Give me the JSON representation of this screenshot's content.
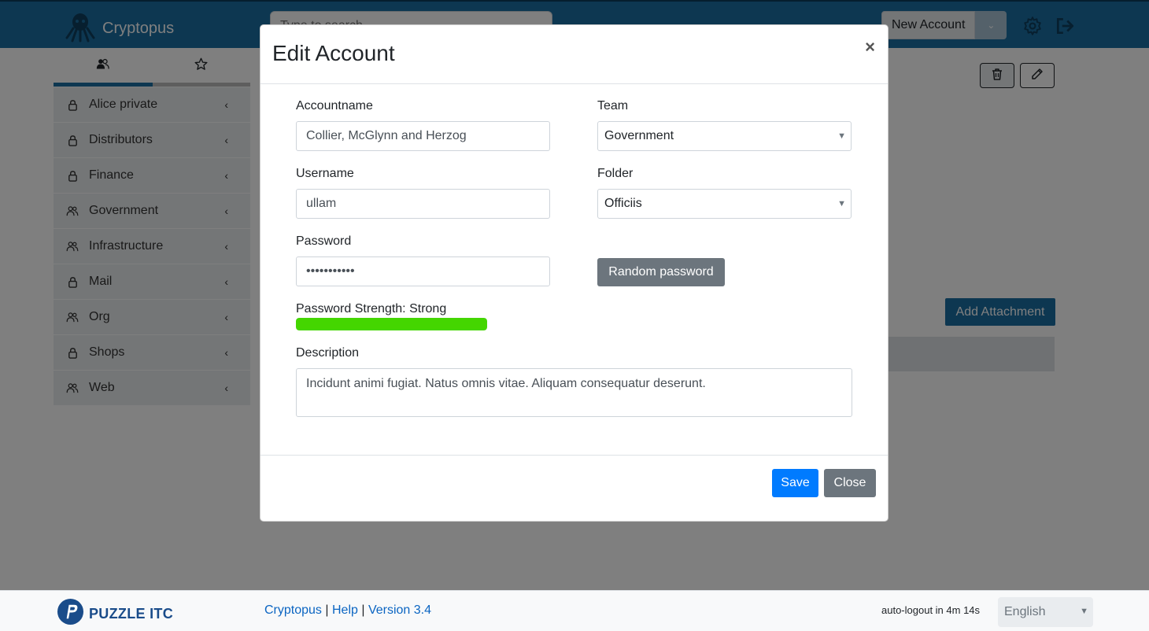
{
  "header": {
    "app_name": "Cryptopus",
    "search_placeholder": "Type to search",
    "new_account_label": "New Account",
    "icons": [
      "octopus-logo-icon",
      "chevron-down-icon",
      "gear-icon",
      "logout-icon"
    ]
  },
  "sidebar": {
    "tabs": [
      {
        "name": "teams",
        "icon": "users-icon",
        "active": true
      },
      {
        "name": "favourites",
        "icon": "star-icon",
        "active": false
      }
    ],
    "items": [
      {
        "label": "Alice private",
        "icon": "lock-icon"
      },
      {
        "label": "Distributors",
        "icon": "lock-icon"
      },
      {
        "label": "Finance",
        "icon": "lock-icon"
      },
      {
        "label": "Government",
        "icon": "users-icon"
      },
      {
        "label": "Infrastructure",
        "icon": "users-icon"
      },
      {
        "label": "Mail",
        "icon": "lock-icon"
      },
      {
        "label": "Org",
        "icon": "users-icon"
      },
      {
        "label": "Shops",
        "icon": "lock-icon"
      },
      {
        "label": "Web",
        "icon": "users-icon"
      }
    ]
  },
  "main": {
    "add_attachment_label": "Add Attachment"
  },
  "modal": {
    "title": "Edit Account",
    "close_symbol": "×",
    "accountname_label": "Accountname",
    "accountname_value": "Collier, McGlynn and Herzog",
    "team_label": "Team",
    "team_value": "Government",
    "username_label": "Username",
    "username_value": "ullam",
    "folder_label": "Folder",
    "folder_value": "Officiis",
    "password_label": "Password",
    "password_value": "•••••••••••",
    "random_password_label": "Random password",
    "strength_label": "Password Strength: Strong",
    "strength_fraction": 1.0,
    "description_label": "Description",
    "description_value": "Incidunt animi fugiat. Natus omnis vitae. Aliquam consequatur deserunt.",
    "save_label": "Save",
    "close_label": "Close"
  },
  "footer": {
    "brand": "PUZZLE ITC",
    "link_cryptopus": "Cryptopus",
    "sep1": "|",
    "link_help": "Help",
    "sep2": "|",
    "link_version": "Version 3.4",
    "autologout": "auto-logout in 4m 14s",
    "language": "English"
  },
  "colors": {
    "header_bg": "#1a6fa3",
    "primary": "#007bff",
    "secondary": "#6c757d",
    "strength_strong": "#44d600"
  }
}
